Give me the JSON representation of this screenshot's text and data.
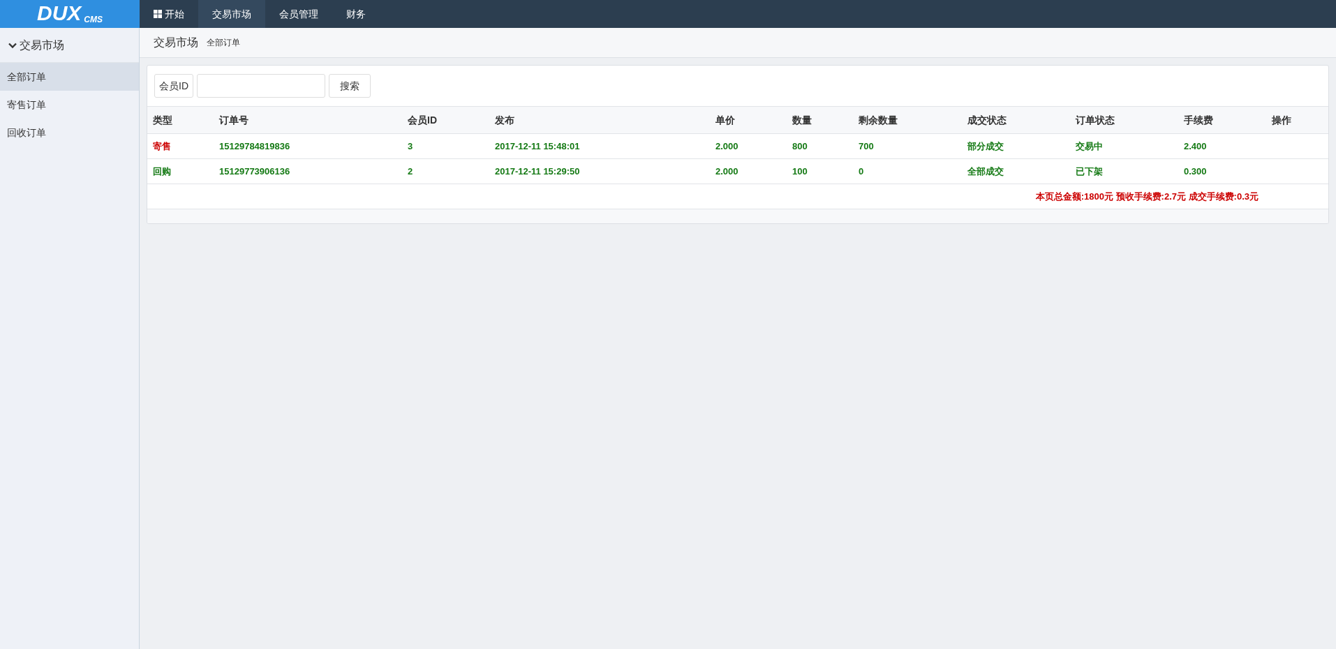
{
  "logo": {
    "main": "DUX",
    "sub": "CMS"
  },
  "nav": [
    {
      "label": "开始",
      "icon": true,
      "selected": false
    },
    {
      "label": "交易市场",
      "icon": false,
      "selected": true
    },
    {
      "label": "会员管理",
      "icon": false,
      "selected": false
    },
    {
      "label": "财务",
      "icon": false,
      "selected": false
    }
  ],
  "sidebar": {
    "heading": "交易市场",
    "expanded": true,
    "items": [
      {
        "label": "全部订单",
        "selected": true
      },
      {
        "label": "寄售订单",
        "selected": false
      },
      {
        "label": "回收订单",
        "selected": false
      }
    ]
  },
  "breadcrumb": {
    "title": "交易市场",
    "sub": "全部订单"
  },
  "search": {
    "label": "会员ID",
    "button": "搜索"
  },
  "table": {
    "columns": [
      "类型",
      "订单号",
      "会员ID",
      "发布",
      "单价",
      "数量",
      "剩余数量",
      "成交状态",
      "订单状态",
      "手续费",
      "操作"
    ],
    "rows": [
      {
        "kind": "sell",
        "cells": [
          "寄售",
          "15129784819836",
          "3",
          "2017-12-11 15:48:01",
          "2.000",
          "800",
          "700",
          "部分成交",
          "交易中",
          "2.400",
          ""
        ]
      },
      {
        "kind": "buy",
        "cells": [
          "回购",
          "15129773906136",
          "2",
          "2017-12-11 15:29:50",
          "2.000",
          "100",
          "0",
          "全部成交",
          "已下架",
          "0.300",
          ""
        ]
      }
    ],
    "summary": "本页总金额:1800元 预收手续费:2.7元 成交手续费:0.3元"
  }
}
